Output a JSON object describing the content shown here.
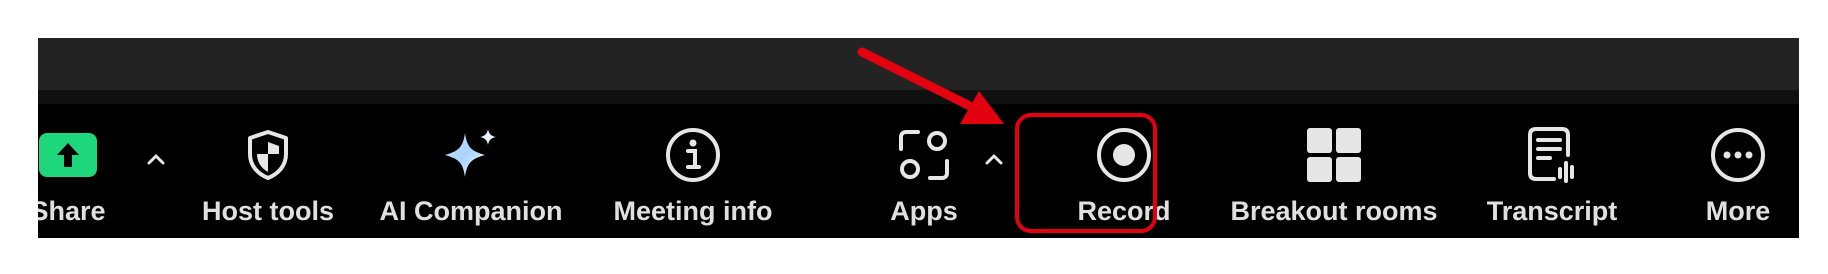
{
  "toolbar": {
    "items": [
      {
        "id": "share",
        "label": "Share",
        "icon": "share-arrow-up-icon",
        "color": "#1ed67b"
      },
      {
        "id": "host-tools",
        "label": "Host tools",
        "icon": "shield-icon"
      },
      {
        "id": "ai-companion",
        "label": "AI Companion",
        "icon": "sparkle-star-icon"
      },
      {
        "id": "meeting-info",
        "label": "Meeting info",
        "icon": "info-icon"
      },
      {
        "id": "apps",
        "label": "Apps",
        "icon": "apps-icon"
      },
      {
        "id": "record",
        "label": "Record",
        "icon": "record-icon"
      },
      {
        "id": "breakout-rooms",
        "label": "Breakout rooms",
        "icon": "grid-icon"
      },
      {
        "id": "transcript",
        "label": "Transcript",
        "icon": "transcript-icon"
      },
      {
        "id": "more",
        "label": "More",
        "icon": "more-dots-icon"
      }
    ]
  },
  "annotation": {
    "highlight_color": "#e3000f",
    "target": "record"
  }
}
